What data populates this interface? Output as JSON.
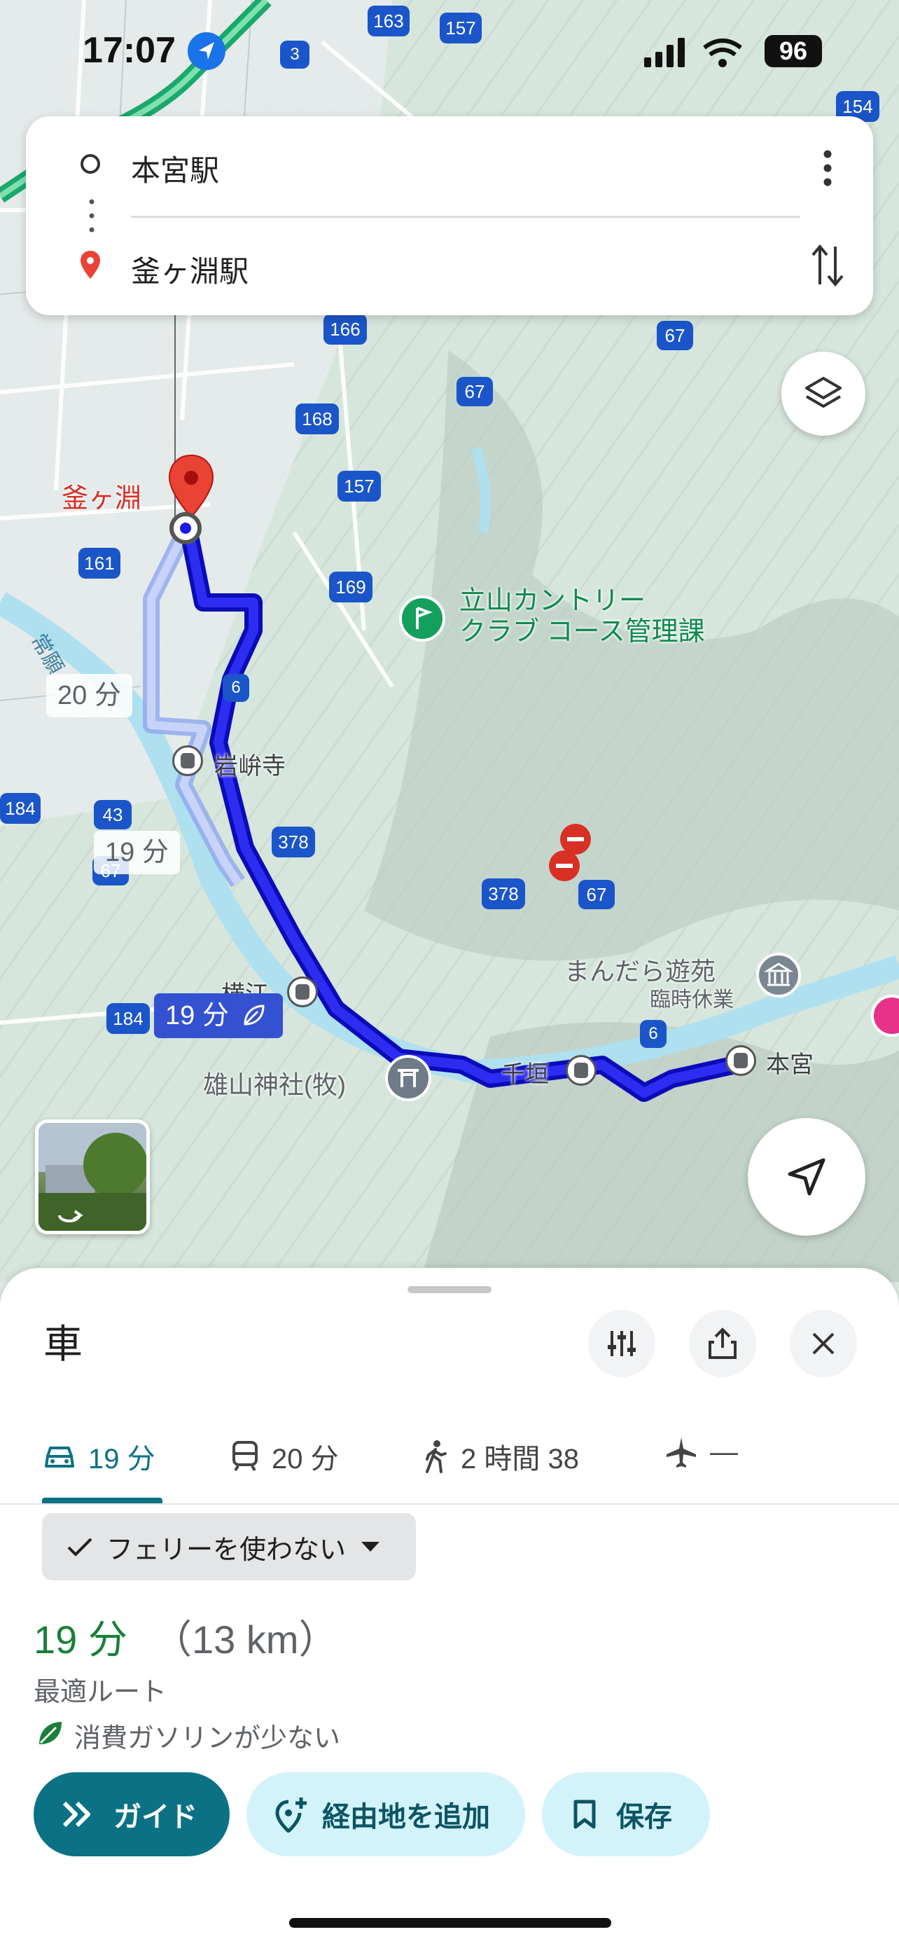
{
  "status_bar": {
    "time": "17:07",
    "battery": "96"
  },
  "search": {
    "origin": "本宮駅",
    "destination": "釜ヶ淵駅"
  },
  "map": {
    "road_shields": [
      "163",
      "157",
      "3",
      "154",
      "166",
      "67",
      "67",
      "168",
      "157",
      "169",
      "161",
      "6",
      "184",
      "43",
      "67",
      "378",
      "378",
      "67",
      "184",
      "6"
    ],
    "labels": {
      "kamagafuchi": "釜ヶ淵",
      "golf": "立山カントリー\nクラブ コース管理課",
      "iwakuraji": "岩峅寺",
      "yokoe": "横江",
      "oyama_shrine": "雄山神社(牧)",
      "chigaki": "千垣",
      "hongu": "本宮",
      "mandara": "まんだら遊苑",
      "mandara_status": "臨時休業",
      "alt_route_1": "20 分",
      "alt_route_2": "19 分",
      "main_route": "19 分",
      "river": "常願"
    }
  },
  "sheet": {
    "title": "車",
    "tabs": [
      {
        "mode": "car",
        "label": "19 分",
        "active": true
      },
      {
        "mode": "transit",
        "label": "20 分",
        "active": false
      },
      {
        "mode": "walk",
        "label": "2 時間 38",
        "active": false
      },
      {
        "mode": "flight",
        "label": "—",
        "active": false
      }
    ],
    "filter_chip": "フェリーを使わない",
    "eta": "19 分",
    "distance": "（13 km）",
    "route_desc": "最適ルート",
    "eco_note": "消費ガソリンが少ない",
    "buttons": {
      "guide": "ガイド",
      "add_stop": "経由地を追加",
      "save": "保存"
    }
  },
  "colors": {
    "route": "#1a1ae6",
    "accent": "#0b7285",
    "eta": "#188038",
    "pin": "#ea4335"
  }
}
